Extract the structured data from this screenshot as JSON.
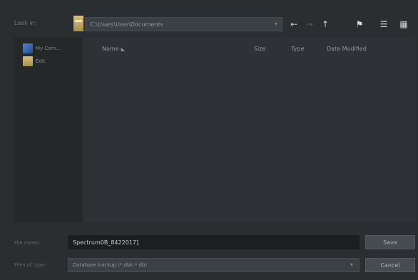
{
  "topbar": {
    "look_in_label": "Look in:",
    "path": "C:\\Users\\User\\Documents",
    "back_icon": "←",
    "forward_icon": "→",
    "up_icon": "↑",
    "new_folder_icon": "⚑",
    "list_view_icon": "☰",
    "detail_view_icon": "▦"
  },
  "places": {
    "items": [
      {
        "label": "My Com..."
      },
      {
        "label": "Edit"
      }
    ]
  },
  "file_list": {
    "columns": [
      "Name",
      "Size",
      "Type",
      "Date Modified"
    ]
  },
  "filename": {
    "label": "File name:",
    "value": "Spectrum0B_8422017]"
  },
  "filetype": {
    "label": "Files of type:",
    "value": "Database backup (*.dbk *.db)"
  },
  "buttons": {
    "save": "Save",
    "cancel": "Cancel"
  }
}
